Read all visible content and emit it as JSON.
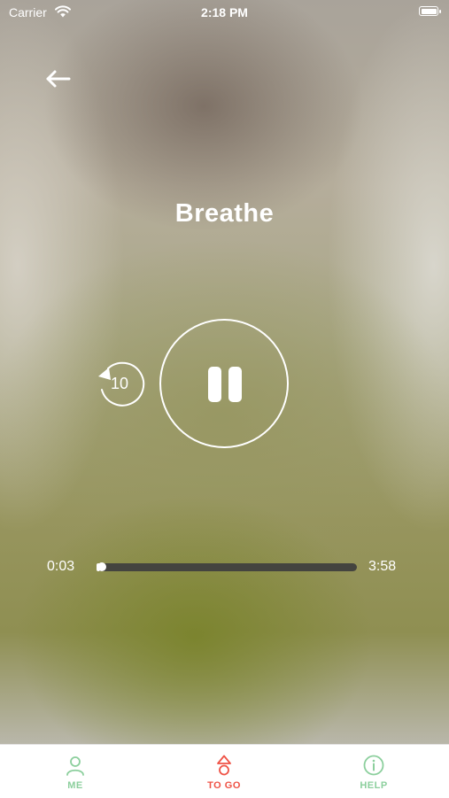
{
  "status_bar": {
    "carrier": "Carrier",
    "time": "2:18 PM",
    "battery_level": 1.0
  },
  "player": {
    "title": "Breathe",
    "replay_label": "10",
    "elapsed": "0:03",
    "duration": "3:58",
    "progress": 0.013,
    "state": "playing"
  },
  "icons": {
    "back": "arrow-left-icon",
    "replay": "replay-10-icon",
    "pause": "pause-icon",
    "me": "person-icon",
    "to_go": "triangle-circle-icon",
    "help": "info-icon"
  },
  "tab_bar": {
    "me_label": "ME",
    "to_go_label": "TO GO",
    "help_label": "HELP",
    "active_color": "#ef5245",
    "inactive_color": "#8ccf9d"
  }
}
